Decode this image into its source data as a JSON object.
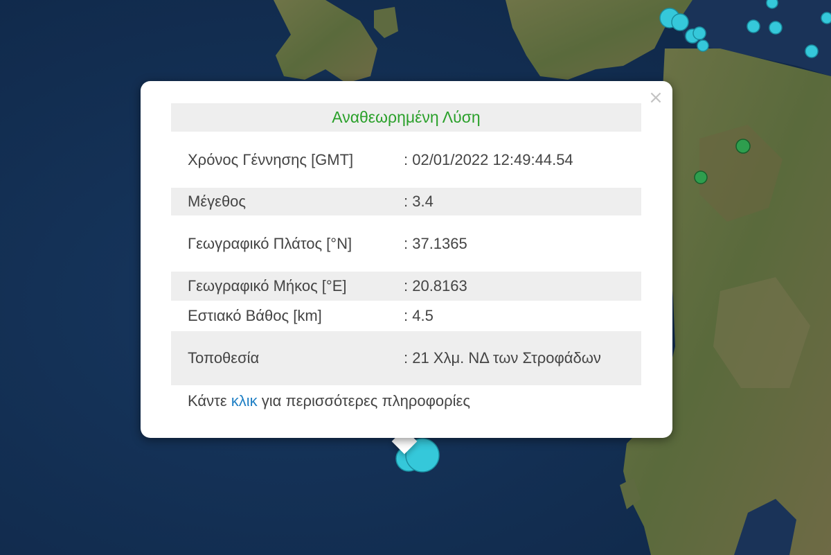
{
  "map": {
    "colors": {
      "sea": "#16335c",
      "sea_deep": "#0f2747",
      "land": "#5c6b3f",
      "land_light": "#7a7650",
      "marker_cyan": "#35c8da",
      "marker_green": "#2e9e4e"
    },
    "markers": [
      {
        "name": "earthquake-marker-cyan",
        "color": "cyan",
        "size": "large"
      },
      {
        "name": "earthquake-marker-green",
        "color": "green",
        "size": "small"
      }
    ]
  },
  "popup": {
    "title": "Αναθεωρημένη Λύση",
    "close_symbol": "×",
    "rows": [
      {
        "label": "Χρόνος Γέννησης [GMT]",
        "value": ": 02/01/2022 12:49:44.54"
      },
      {
        "label": "Μέγεθος",
        "value": ": 3.4"
      },
      {
        "label": "Γεωγραφικό Πλάτος [°N]",
        "value": ": 37.1365"
      },
      {
        "label": "Γεωγραφικό Μήκος [°E]",
        "value": ": 20.8163"
      },
      {
        "label": "Εστιακό Βάθος [km]",
        "value": ": 4.5"
      },
      {
        "label": "Τοποθεσία",
        "value": ": 21 Χλμ. ΝΔ των Στροφάδων"
      }
    ],
    "more_prefix": "Κάντε",
    "more_link": "κλικ",
    "more_suffix": "για περισσότερες πληροφορίες"
  }
}
